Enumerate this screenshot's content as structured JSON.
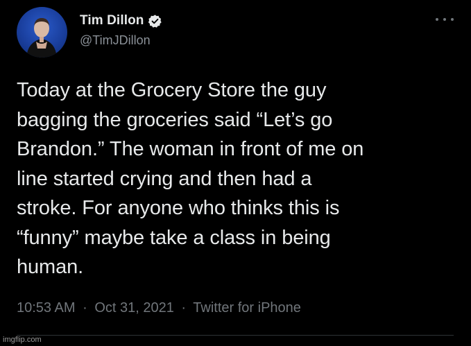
{
  "tweet": {
    "display_name": "Tim Dillon",
    "handle": "@TimJDillon",
    "verified": true,
    "text": "Today at the Grocery Store the guy\nbagging the groceries said “Let’s go\nBrandon.” The woman in front of me on\nline started crying and then had a\nstroke. For anyone who thinks this is\n“funny” maybe take a class in being\nhuman.",
    "time": "10:53 AM",
    "separator": "·",
    "date": "Oct 31, 2021",
    "source": "Twitter for iPhone"
  },
  "icons": {
    "verified": "verified-badge-icon",
    "more": "more-options-icon"
  },
  "colors": {
    "background": "#000000",
    "primary_text": "#e7e9ea",
    "secondary_text": "#71767b",
    "avatar_bg": "#1a3f9e"
  },
  "watermark": "imgflip.com"
}
